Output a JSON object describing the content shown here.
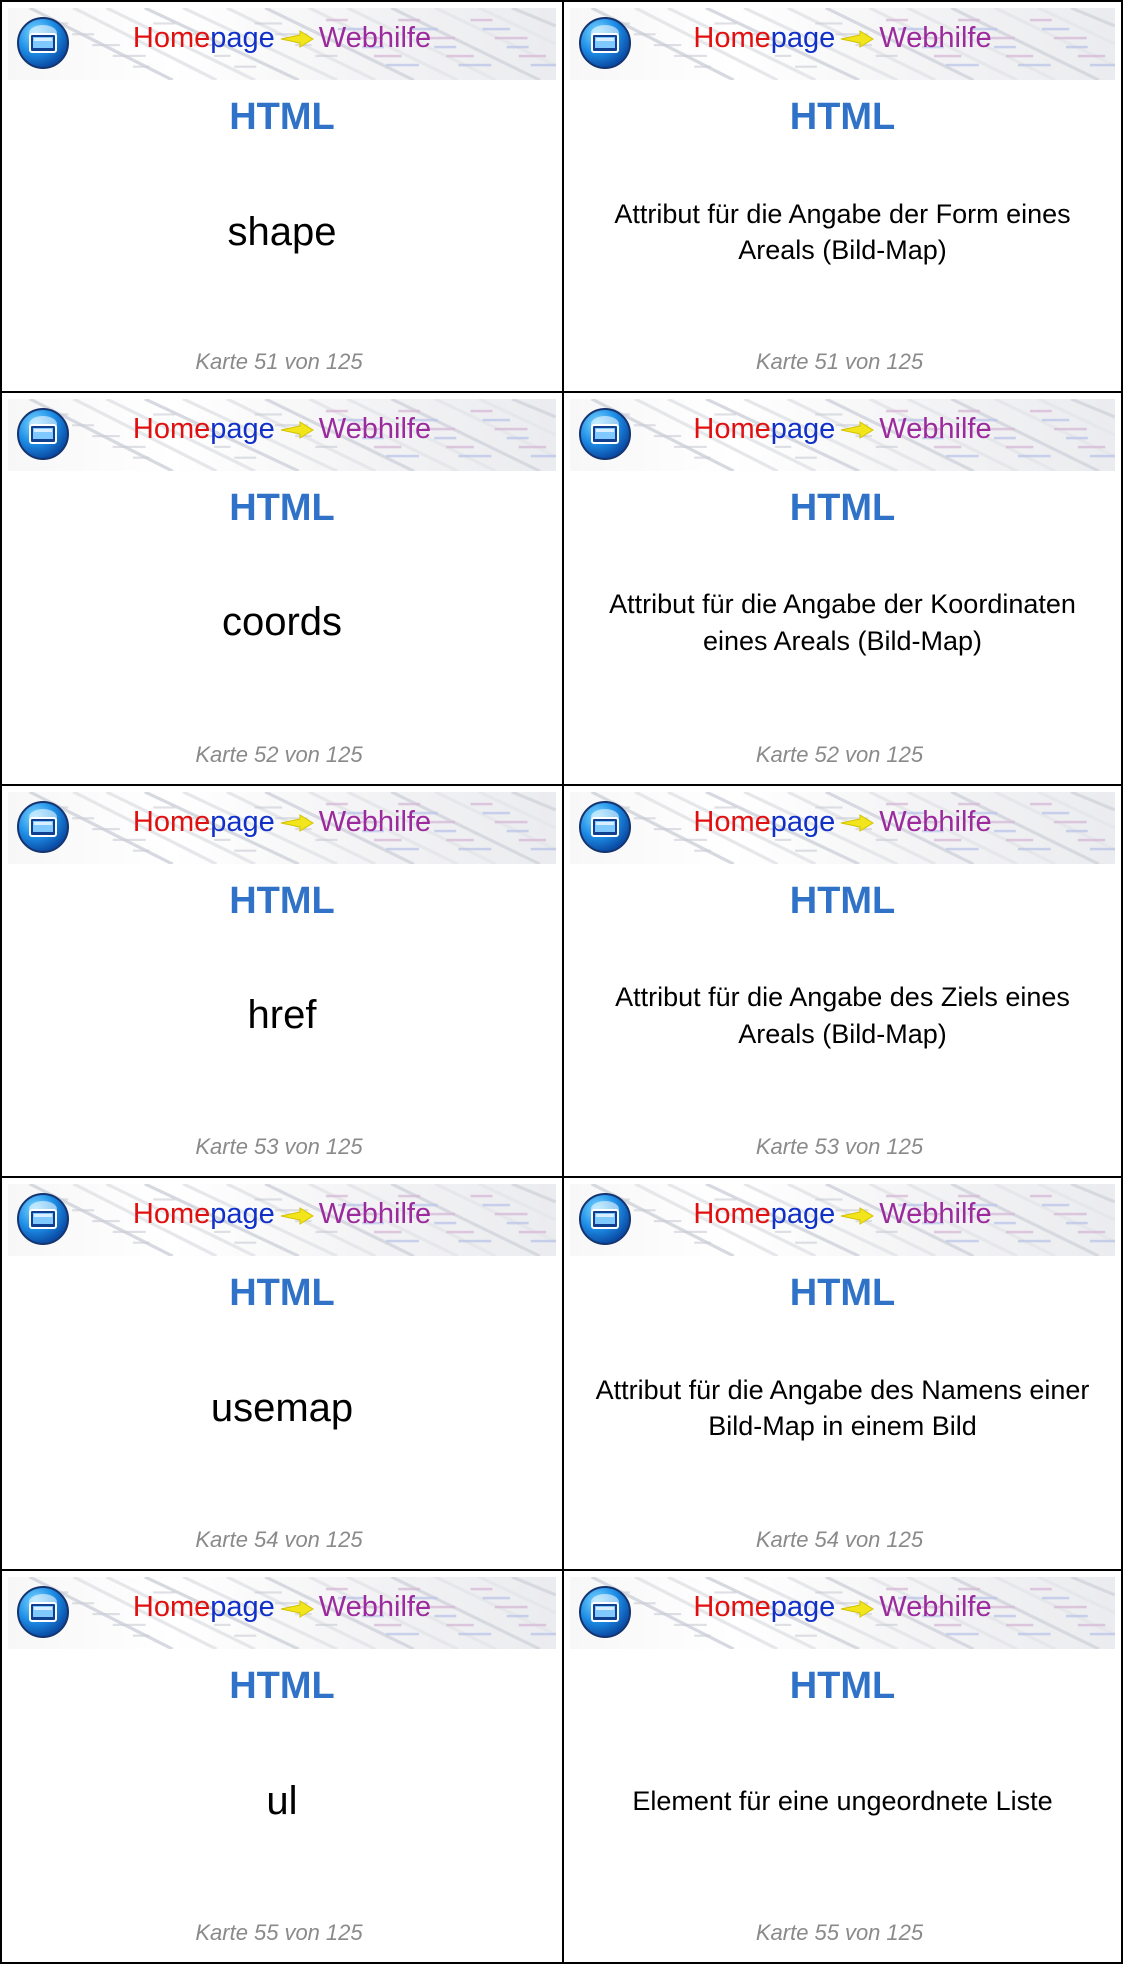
{
  "sheet": {
    "brand": {
      "home": "Home",
      "page": "page",
      "web": "Webhilfe"
    },
    "subject": "HTML",
    "footer_prefix": "Karte",
    "footer_of": "von",
    "total_cards": "125",
    "cards": [
      {
        "number": "51",
        "front": "shape",
        "back": "Attribut für die Angabe der Form eines Areals (Bild-Map)"
      },
      {
        "number": "52",
        "front": "coords",
        "back": "Attribut für die Angabe der Koordinaten eines Areals (Bild-Map)"
      },
      {
        "number": "53",
        "front": "href",
        "back": "Attribut für die Angabe des Ziels eines Areals (Bild-Map)"
      },
      {
        "number": "54",
        "front": "usemap",
        "back": "Attribut für die Angabe des Namens einer Bild-Map in einem Bild"
      },
      {
        "number": "55",
        "front": "ul",
        "back": "Element für eine ungeordnete Liste"
      }
    ]
  },
  "colors": {
    "subject": "#3072c8",
    "footer": "#8a8a8a",
    "brand_home": "#e01010",
    "brand_page": "#1030c8",
    "brand_web": "#9b2a9d",
    "arrow": "#f2e51b",
    "border": "#000000"
  },
  "icons": {
    "logo": "homepage-webhilfe-logo-icon",
    "arrow": "yellow-arrow-icon"
  }
}
